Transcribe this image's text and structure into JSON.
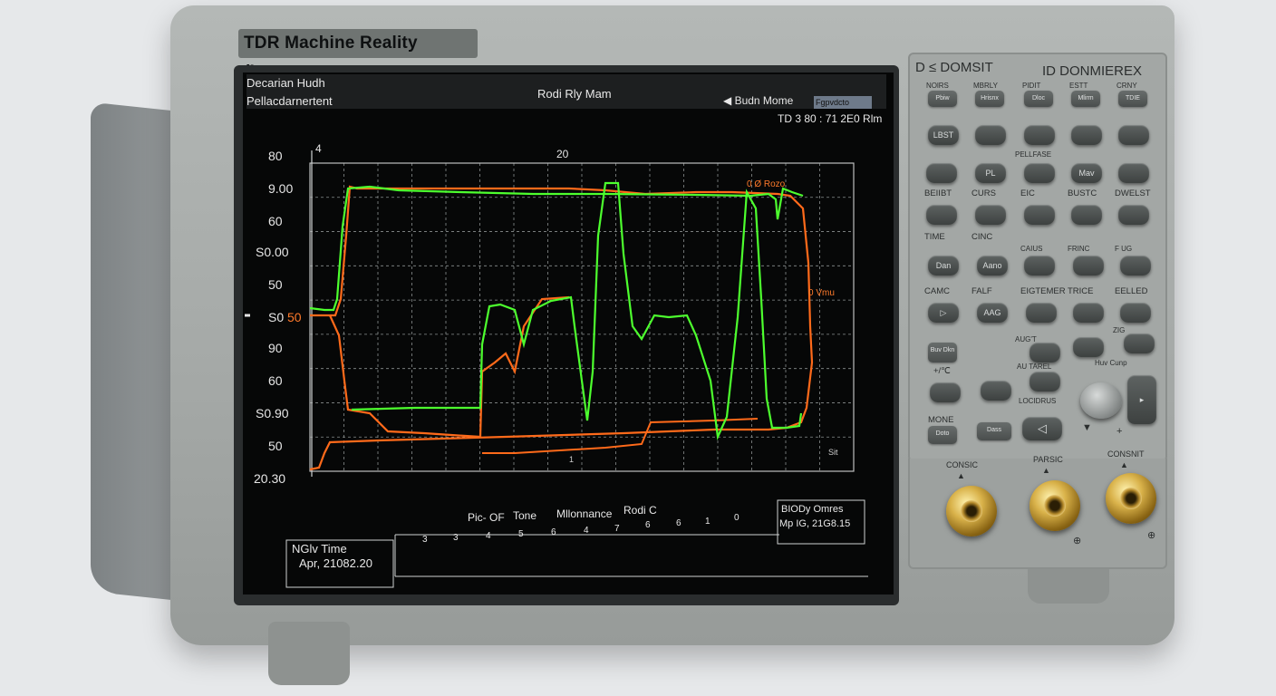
{
  "device": {
    "brand_label": "TDR Machine Reality (Lucem",
    "panel_title_left": "D ≤ DOMSIT",
    "panel_title_right": "ID DONMIEREX"
  },
  "screen": {
    "header_left_line1": "Decarian Hudh",
    "header_left_line2": "Pellacdarnertent",
    "header_center": "Rodi Rly Mam",
    "header_mode": "Budn Mome",
    "header_mode_box": "Fgpvdcto",
    "header_readout": "TD 3 80 : 71 2E0 Rlm",
    "top_marker_left": "4",
    "top_marker_center": "20",
    "right_marker_1": "0 Ø Rozo",
    "right_marker_2": "0 Vmu",
    "corner_label": "Sit",
    "bottom_marker": "1",
    "y_ticks": [
      "80",
      "9.00",
      "60",
      "S0.00",
      "50",
      "S0",
      "90",
      "60",
      "S0.90",
      "50",
      "20.30"
    ],
    "y_tick_highlight": "50",
    "bottom_headers": [
      "Pic- OF",
      "Tone",
      "Mllonnance",
      "Rodi C"
    ],
    "bottom_numbers": [
      "3",
      "3",
      "4",
      "5",
      "6",
      "4",
      "7",
      "6",
      "6",
      "1",
      "0"
    ],
    "info_left_line1": "NGlv Time",
    "info_left_line2": "Apr, 21082.20",
    "info_right_line1": "BIODy Omres",
    "info_right_line2": "Mp IG, 21G8.15",
    "colors": {
      "trace_green": "#4dff2e",
      "trace_orange": "#ff6a1a",
      "grid": "#8a8f8f"
    }
  },
  "panel": {
    "top_small_buttons": [
      {
        "label": "NOlRS",
        "cap": "Pbiw"
      },
      {
        "label": "MBRLY",
        "cap": "Hrisnx"
      },
      {
        "label": "PIDIT",
        "cap": "Dloc"
      },
      {
        "label": "ESTT",
        "cap": "Mlirm"
      },
      {
        "label": "CRNY",
        "cap": "TDIE"
      }
    ],
    "row1": [
      "LBST",
      "",
      "",
      "",
      ""
    ],
    "row2": [
      "",
      "PL",
      "",
      "Mav",
      ""
    ],
    "row2_label": "PELLFASE",
    "row3_labels": [
      "BEIIBT",
      "CURS",
      "EIC",
      "BUSTC",
      "DWELST"
    ],
    "row4_labels": [
      "TIME",
      "CINC",
      "",
      "",
      ""
    ],
    "row4_sub": [
      "",
      "",
      "CAIUS",
      "FRINC",
      "F UG"
    ],
    "row5": [
      "Dan",
      "Aano",
      "",
      "",
      ""
    ],
    "row5_labels": [
      "CAMC",
      "FALF",
      "EIGTEMER",
      "TRICE",
      "EELLED"
    ],
    "row6": [
      "▷",
      "AAG",
      "",
      "",
      ""
    ],
    "aux_labels": [
      "AUG'T",
      "AU TAREL",
      "LOCIDRUS",
      "ZIG"
    ],
    "side_labels": [
      "Buv Dkn",
      "+/℃",
      "MONE",
      "Doto"
    ],
    "hold_btn": "Dass",
    "arrow_btn": "◁",
    "hadd": "Huv Cunp",
    "conn_labels": [
      "CONSIC",
      "PARSIC",
      "CONSNIT"
    ]
  }
}
